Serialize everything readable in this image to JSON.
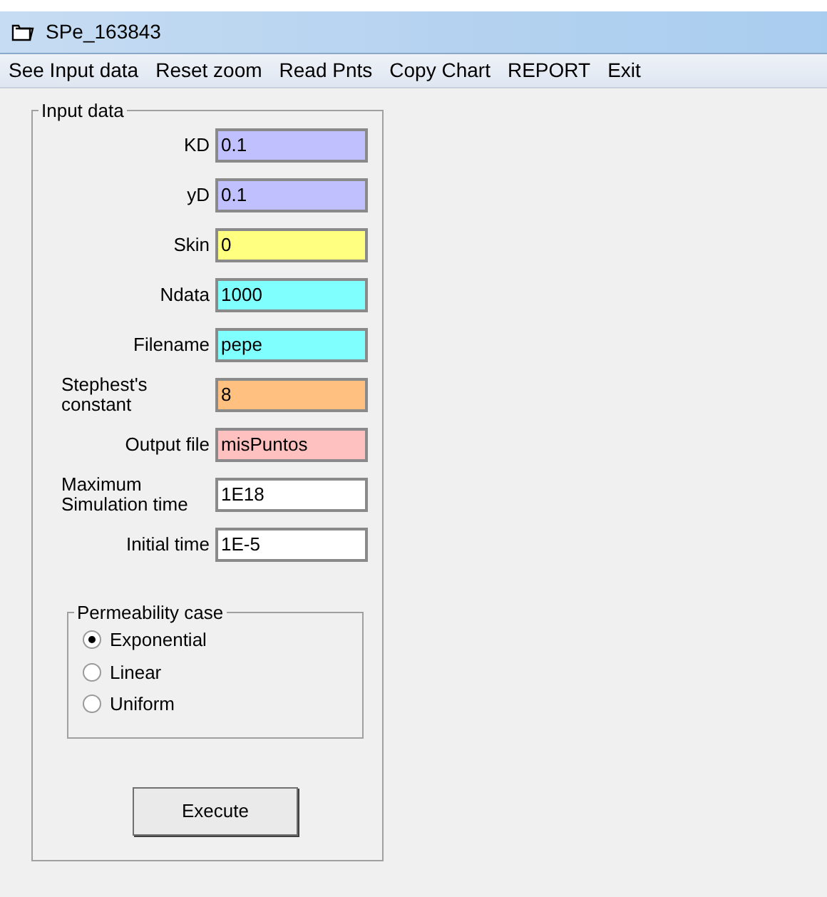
{
  "window": {
    "title": "SPe_163843"
  },
  "menu": [
    "See Input data",
    "Reset zoom",
    "Read Pnts",
    "Copy Chart",
    "REPORT",
    "Exit"
  ],
  "input_data": {
    "title": "Input data",
    "fields": [
      {
        "label": "KD",
        "value": "0.1",
        "color": "#c0c0ff"
      },
      {
        "label": "yD",
        "value": "0.1",
        "color": "#c0c0ff"
      },
      {
        "label": "Skin",
        "value": "0",
        "color": "#ffff80"
      },
      {
        "label": "Ndata",
        "value": "1000",
        "color": "#80ffff"
      },
      {
        "label": "Filename",
        "value": "pepe",
        "color": "#80ffff"
      },
      {
        "label": "Stephest's constant",
        "value": "8",
        "color": "#ffc080"
      },
      {
        "label": "Output file",
        "value": "misPuntos",
        "color": "#ffc0c0"
      },
      {
        "label": "Maximum Simulation time",
        "value": "1E18",
        "color": "#ffffff"
      },
      {
        "label": "Initial time",
        "value": "1E-5",
        "color": "#ffffff"
      }
    ],
    "permeability_case": {
      "title": "Permeability case",
      "options": [
        {
          "label": "Exponential",
          "selected": true
        },
        {
          "label": "Linear",
          "selected": false
        },
        {
          "label": "Uniform",
          "selected": false
        }
      ]
    },
    "execute_button": "Execute"
  }
}
